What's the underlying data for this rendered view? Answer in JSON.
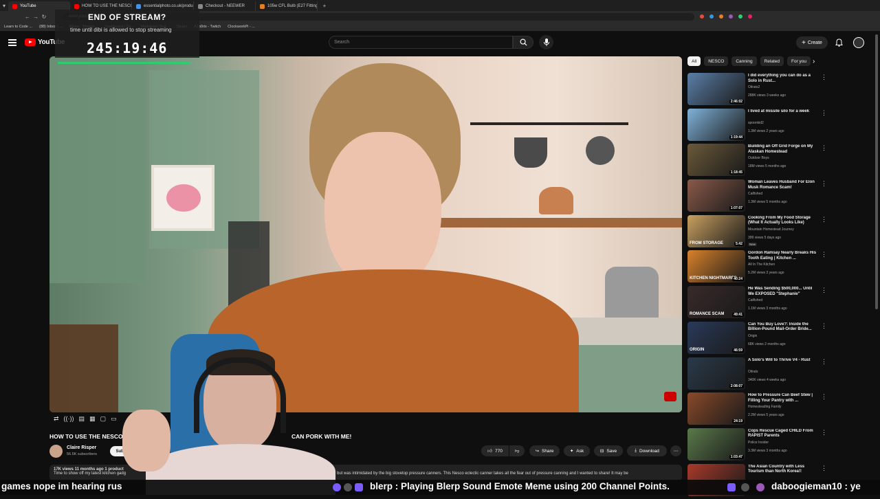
{
  "browser": {
    "tabs": [
      {
        "label": "YouTube",
        "color": "#ff0000",
        "active": true
      },
      {
        "label": "HOW TO USE THE NESCO E",
        "color": "#ff0000",
        "active": false
      },
      {
        "label": "essentialphoto.co.uk/produ",
        "color": "#4a90e2",
        "active": false
      },
      {
        "label": "Checkout - NEEWER",
        "color": "#888888",
        "active": false
      },
      {
        "label": "105w CFL Bulb (E27 Fitting)",
        "color": "#e67e22",
        "active": false
      }
    ],
    "new_tab": "+",
    "url": "www.youtube.com",
    "bookmarks": [
      "Learn to Code ...",
      "(88) Inbox | ...",
      "Rinse - Stream...",
      "Dashboard | Tw...",
      "Markdown Text...",
      "Steam",
      "A1b0rix - Twitch",
      "ClockworkPi - ..."
    ]
  },
  "stream_overlay": {
    "title": "END OF STREAM?",
    "subtitle": "time until dibi is allowed to stop streaming",
    "timer": "245:19:46",
    "progress": 0.98
  },
  "youtube": {
    "logo_text": "YouTube",
    "search_placeholder": "Search",
    "create_label": "Create",
    "chips": [
      "All",
      "NESCO",
      "Canning",
      "Related",
      "For you"
    ],
    "video": {
      "title_visible_start": "HOW TO USE THE NESCO ELE",
      "title_visible_end": "CAN PORK WITH ME!",
      "channel": "Claire Risper",
      "subscribers": "56.5K subscribers",
      "subscribe_label": "Subscribe",
      "likes": "770",
      "share_label": "Share",
      "ask_label": "Ask",
      "save_label": "Save",
      "download_label": "Download",
      "stats": "17K views  11 months ago  1 product",
      "description_start": "Time to show off my latest kitchen gadg",
      "description_end": "but was intimidated by the big stovetop pressure canners. This Nesco eclectic canner takes all the fear out of pressure canning and I wanted to share! It may be"
    },
    "recommendations": [
      {
        "title": "I did everything you can do as a Solo in Rust...",
        "channel": "Oilrats2",
        "meta": "288K views  3 weeks ago",
        "duration": "2:46:02",
        "bg": "#5b7fa8"
      },
      {
        "title": "I lived at missile silo for a week",
        "channel": "spoonkid2",
        "meta": "1.3M views  2 years ago",
        "duration": "1:19:44",
        "bg": "#7fb2d9"
      },
      {
        "title": "Building an Off Grid Forge on My Alaskan Homestead",
        "channel": "Outdoor Boys",
        "meta": "18M views  5 months ago",
        "duration": "1:18:45",
        "bg": "#6b5a3a"
      },
      {
        "title": "Woman Leaves Husband For Elon Musk Romance Scam!",
        "channel": "Catfished",
        "meta": "1.3M views  5 months ago",
        "duration": "1:07:07",
        "bg": "#8a5a4a"
      },
      {
        "title": "Cooking From My Food Storage (What It Actually Looks Like)",
        "channel": "Mountain Homestead Journey",
        "meta": "399 views  5 days ago",
        "duration": "5:42",
        "bg": "#c9a060",
        "overlay_text": "FROM STORAGE",
        "badge": "New"
      },
      {
        "title": "Gordon Ramsay Nearly Breaks His Tooth Eating | Kitchen ...",
        "channel": "All In The Kitchen",
        "meta": "5.2M views  3 years ago",
        "duration": "40:24",
        "bg": "#d9822b",
        "overlay_text": "KITCHEN NIGHTMARES"
      },
      {
        "title": "He Was Sending $500,000... Until We EXPOSED \"Stephanie\"",
        "channel": "Catfished",
        "meta": "1.1M views  3 months ago",
        "duration": "49:41",
        "bg": "#3a2a2a",
        "overlay_text": "ROMANCE SCAM"
      },
      {
        "title": "Can You Buy Love?: Inside the Billion-Pound Mail-Order Bride...",
        "channel": "Origin",
        "meta": "68K views  2 months ago",
        "duration": "46:59",
        "bg": "#2a3a5a",
        "overlay_text": "ORIGIN"
      },
      {
        "title": "A Solo's Will to Thrive V4 - Rust",
        "channel": "Oilrats",
        "meta": "340K views  4 weeks ago",
        "duration": "2:08:07",
        "bg": "#2a3a4a"
      },
      {
        "title": "How to Pressure Can Beef Stew | Filling Your Pantry with ...",
        "channel": "Homesteading Family",
        "meta": "2.2M views  5 years ago",
        "duration": "24:19",
        "bg": "#8a4a2a"
      },
      {
        "title": "Cops Rescue Caged CHILD From RAPIST Parents",
        "channel": "Police Insider",
        "meta": "3.3M views  3 months ago",
        "duration": "1:03:47",
        "bg": "#5a7a4a"
      },
      {
        "title": "The Asian Country with Less Tourism than North Korea!!",
        "channel": "",
        "meta": "",
        "duration": "",
        "bg": "#a83a2a"
      }
    ]
  },
  "chat_ticker": {
    "seg1": "games nope im hearing rus",
    "seg2": "blerp : Playing Blerp Sound Emote Meme using 200 Channel Points.",
    "seg3": "daboogieman10 : ye"
  },
  "colors": {
    "accent": "#ff0000",
    "bg": "#0f0f0f",
    "timer_bar": "#2ecc71",
    "blerp": "#ff3b6b"
  }
}
